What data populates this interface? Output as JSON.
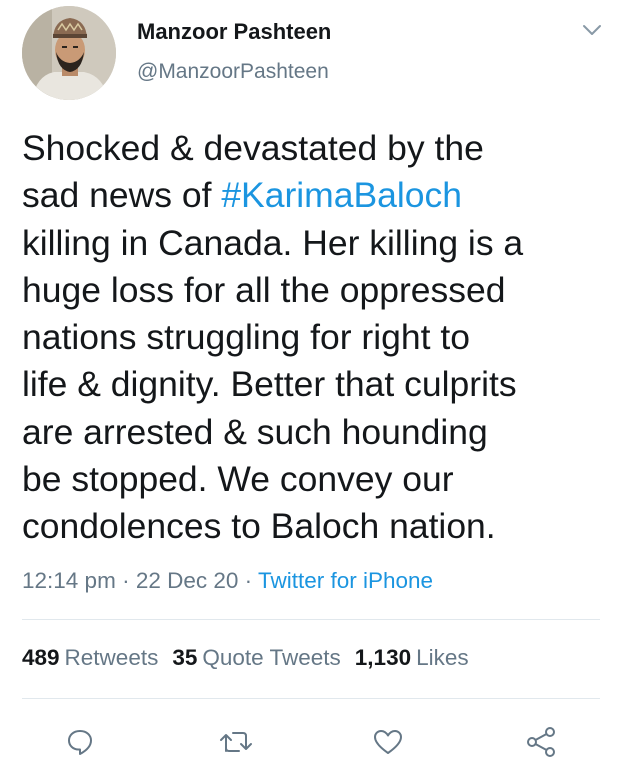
{
  "tweet": {
    "author": {
      "display_name": "Manzoor Pashteen",
      "handle": "@ManzoorPashteen"
    },
    "text_before_hashtag": "Shocked & devastated by the\nsad news of ",
    "hashtag": "#KarimaBaloch",
    "text_after_hashtag": "\nkilling in Canada. Her killing is a\nhuge loss for all the oppressed\nnations struggling for right to\nlife & dignity.  Better that culprits\nare arrested & such hounding\nbe stopped. We convey our\ncondolences to Baloch nation.",
    "time": "12:14 pm",
    "date": "22 Dec 20",
    "separator": " · ",
    "source": "Twitter for iPhone"
  },
  "stats": {
    "retweets_count": "489",
    "retweets_label": "Retweets",
    "quote_tweets_count": "35",
    "quote_tweets_label": "Quote Tweets",
    "likes_count": "1,130",
    "likes_label": "Likes"
  },
  "icons": {
    "menu": "chevron-down-icon",
    "reply": "reply-bubble-icon",
    "retweet": "retweet-arrows-icon",
    "like": "heart-icon",
    "share": "share-nodes-icon"
  },
  "colors": {
    "text": "#14171a",
    "secondary": "#657786",
    "link": "#1b95e0",
    "divider": "#e1e8ed"
  }
}
